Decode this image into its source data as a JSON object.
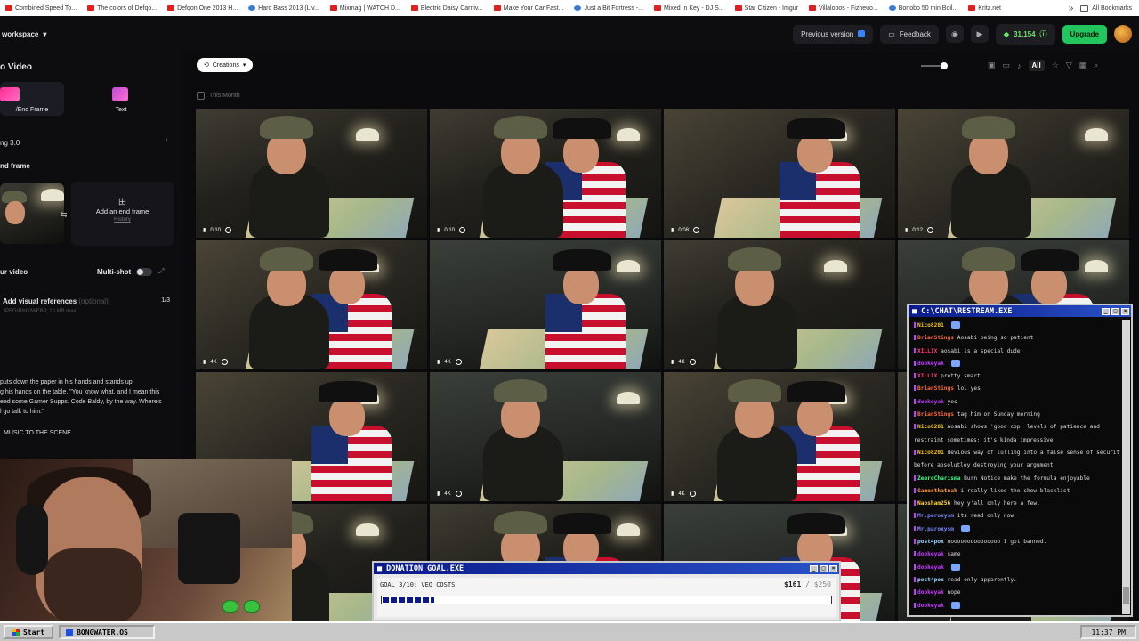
{
  "bookmarks": {
    "items": [
      "Combined Speed To...",
      "The colors of Defqo...",
      "Defqon One 2013 H...",
      "Hard Bass 2013 (Liv...",
      "Mixmag | WATCH D...",
      "Electric Daisy Carniv...",
      "Make Your Car Fast...",
      "Just a Bit Fortress -...",
      "Mixed In Key - DJ S...",
      "Star Citizen - Imgur",
      "Villalobos - Fizheuo...",
      "Bonobo 50 min Boil...",
      "Kritz.net"
    ],
    "more": "»",
    "all_label": "All Bookmarks"
  },
  "header": {
    "workspace": "workspace",
    "previous_version": "Previous version",
    "feedback": "Feedback",
    "credits": "31,154",
    "upgrade": "Upgrade"
  },
  "sidebar": {
    "title": "o Video",
    "modes": [
      {
        "label": "/End Frame"
      },
      {
        "label": "Text"
      }
    ],
    "model": "ng 3.0",
    "end_frame_section": "nd frame",
    "add_end_frame": "Add an end frame",
    "history": "History",
    "your_video": "ur video",
    "multishot": "Multi-shot",
    "visual_refs": "Add visual references",
    "visual_refs_optional": "(optional)",
    "visual_refs_formats": "JPEG/PNG/WEBP, 10 MB max",
    "visual_refs_count": "1/3",
    "prompt_lines": [
      "puts down the paper in his hands and stands up",
      "g his hands on the table. \"You know what, and I mean this",
      "eed some Gamer Supps. Code Baldy, by the way. Where's",
      "l go talk to him.\""
    ],
    "music": "MUSIC TO THE SCENE"
  },
  "content": {
    "filter": "Creations",
    "view_all": "All",
    "month": "This Month",
    "tiles": [
      {
        "tag": "0:10",
        "type": "w1"
      },
      {
        "tag": "0:10",
        "type": "w1"
      },
      {
        "tag": "0:08",
        "type": "w2"
      },
      {
        "tag": "0:12",
        "type": "w2"
      },
      {
        "tag": "4K",
        "type": "w2"
      },
      {
        "tag": "4K",
        "type": "w3"
      },
      {
        "tag": "4K",
        "type": "w1"
      },
      {
        "tag": "",
        "type": "w3"
      },
      {
        "tag": "",
        "type": "w2"
      },
      {
        "tag": "4K",
        "type": "w3"
      },
      {
        "tag": "4K",
        "type": "w2"
      },
      {
        "tag": "",
        "type": "w1"
      },
      {
        "tag": "",
        "type": "w1"
      },
      {
        "tag": "",
        "type": "w1"
      },
      {
        "tag": "",
        "type": "w3"
      },
      {
        "tag": "",
        "type": "w3"
      }
    ]
  },
  "chat": {
    "title": "C:\\CHAT\\RESTREAM.EXE",
    "messages": [
      {
        "user": "Nico8201",
        "text": "",
        "color": "#f0c419"
      },
      {
        "user": "BrianStings",
        "text": "Aosabi being so patient",
        "color": "#ff6a3d"
      },
      {
        "user": "XILLIX",
        "text": "aosabi is a special dude",
        "color": "#ff3d6a"
      },
      {
        "user": "dookeyak",
        "text": "",
        "color": "#c43cff"
      },
      {
        "user": "XILLIX",
        "text": "pretty smart",
        "color": "#ff3d6a"
      },
      {
        "user": "BrianStings",
        "text": "lol yes",
        "color": "#ff6a3d"
      },
      {
        "user": "dookeyak",
        "text": "yes",
        "color": "#c43cff"
      },
      {
        "user": "BrianStings",
        "text": "tag him on Sunday morning",
        "color": "#ff6a3d"
      },
      {
        "user": "Nico8201",
        "text": "Aosabi shows 'good cop' levels of patience and",
        "color": "#f0c419"
      },
      {
        "user": "",
        "text": "restraint sometimes; it's kinda impressive",
        "color": "#ddd"
      },
      {
        "user": "Nico8201",
        "text": "devious way of lulling into a false sense of security;",
        "color": "#f0c419"
      },
      {
        "user": "",
        "text": "before absolutley destroying your argument",
        "color": "#ddd"
      },
      {
        "user": "ZeeroCharisma",
        "text": "Burn Notice make the formula enjoyable",
        "color": "#3dff8a"
      },
      {
        "user": "Gamesthatnah",
        "text": "i really liked the show blacklist",
        "color": "#ff9a3d"
      },
      {
        "user": "Naosham256",
        "text": "hey y'all only here a few.",
        "color": "#ffd23d"
      },
      {
        "user": "Mr.paroxysm",
        "text": "its read only now",
        "color": "#7a8aff"
      },
      {
        "user": "Mr.paroxysm",
        "text": "",
        "color": "#7a8aff"
      },
      {
        "user": "post4pox",
        "text": "nooooooooooooooo I got banned.",
        "color": "#9ad8ff"
      },
      {
        "user": "dookeyak",
        "text": "same",
        "color": "#c43cff"
      },
      {
        "user": "dookeyak",
        "text": "",
        "color": "#c43cff"
      },
      {
        "user": "post4pox",
        "text": "read only apparently.",
        "color": "#9ad8ff"
      },
      {
        "user": "dookeyak",
        "text": "nope",
        "color": "#c43cff"
      },
      {
        "user": "dookeyak",
        "text": "",
        "color": "#c43cff"
      }
    ]
  },
  "donation": {
    "title": "DONATION_GOAL.EXE",
    "goal": "GOAL 3/10: VEO COSTS",
    "raised": "$161",
    "target": "/ $250",
    "progress_fraction": 0.115
  },
  "taskbar": {
    "start": "Start",
    "task": "BONGWATER.OS",
    "clock": "11:37 PM"
  }
}
